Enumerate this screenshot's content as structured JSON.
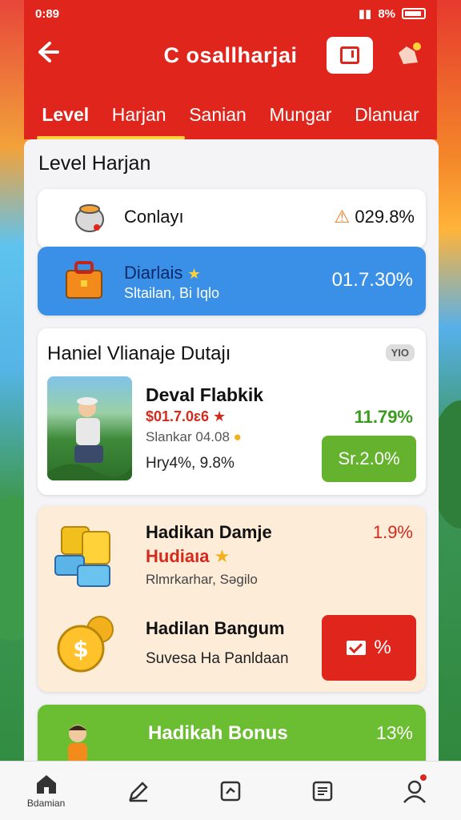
{
  "status_bar": {
    "time": "0:89",
    "battery": "8%"
  },
  "header": {
    "title": "C osallharjai"
  },
  "tabs": [
    "Level",
    "Harjan",
    "Sanian",
    "Mungar",
    "Dlanuar"
  ],
  "section_title": "Level Harjan",
  "list": [
    {
      "name": "Conlayı",
      "value": "029.8%"
    },
    {
      "name": "Diarlais",
      "sub": "Sltailan, Bi Iqlo",
      "value": "01.7.30%"
    }
  ],
  "daily": {
    "heading": "Haniel Vlianaje Dutajı",
    "tag": "YIO",
    "item_title": "Deval Flabkik",
    "item_red": "$01.7.0ɛ6",
    "item_grey": "Slankar 04.08",
    "item_foot": "Hry4%, 9.8%",
    "green_pct": "11.79%",
    "button": "Sr.2.0%"
  },
  "reward": {
    "title1": "Hadikan Damje",
    "title1_pct": "1.9%",
    "title2": "Hudiaıa",
    "title3": "Rlmrkarhar, Səgilo",
    "title4": "Hadilan Bangum",
    "title5": "Suvesa Ha Panldaan",
    "button": "%"
  },
  "bonus": {
    "label": "Hadikah Bonus",
    "value": "13%"
  },
  "bottom_nav": [
    {
      "label": "Bdamian",
      "icon": "home-icon"
    },
    {
      "label": "",
      "icon": "edit-icon"
    },
    {
      "label": "",
      "icon": "chart-icon"
    },
    {
      "label": "",
      "icon": "list-icon"
    },
    {
      "label": "",
      "icon": "profile-icon"
    }
  ],
  "colors": {
    "primary_red": "#e0261c",
    "blue": "#3a8fe6",
    "green": "#64b22e",
    "reward_bg": "#fdecd8"
  }
}
